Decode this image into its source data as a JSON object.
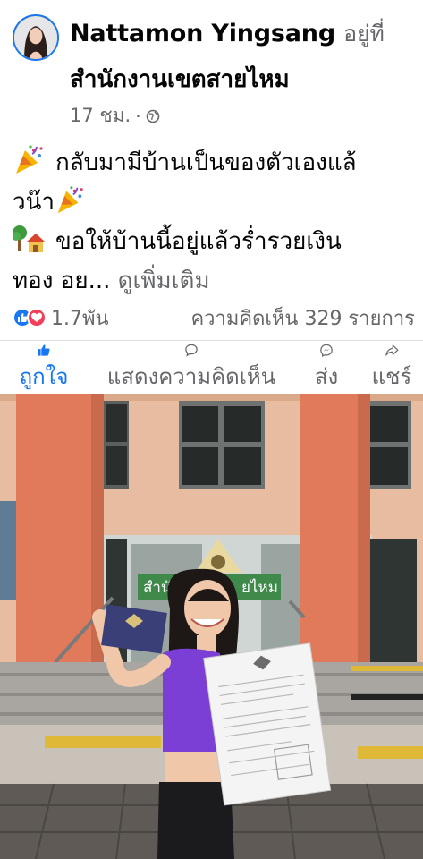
{
  "post": {
    "author": "Nattamon Yingsang",
    "at_word": "อยู่ที่",
    "place": "สำนักงานเขตสายไหม",
    "time": "17 ชม.",
    "separator": "·",
    "privacy_icon": "globe-icon",
    "text_line1": "กลับมามีบ้านเป็นของตัวเองแล้",
    "text_line2": "วน๊า",
    "text_line3": "ขอให้บ้านนี้อยู่แล้วร่ำรวยเงิน",
    "text_line4": "ทอง อย...",
    "see_more": "ดูเพิ่มเติม",
    "emoji_1": "party-popper-emoji",
    "emoji_2": "tree-house-emoji"
  },
  "stats": {
    "reaction_icons": [
      "like-icon",
      "love-icon"
    ],
    "reaction_count": "1.7พัน",
    "comments": "ความคิดเห็น 329 รายการ"
  },
  "actions": [
    {
      "label": "ถูกใจ",
      "icon": "thumbs-up-icon",
      "active": true
    },
    {
      "label": "แสดงความคิดเห็น",
      "icon": "comment-icon",
      "active": false
    },
    {
      "label": "ส่ง",
      "icon": "messenger-icon",
      "active": false
    },
    {
      "label": "แชร์",
      "icon": "share-icon",
      "active": false
    }
  ],
  "photo": {
    "sign_text": "สำนัก",
    "sign_text_right": "ยไหม",
    "colors": {
      "pillar": "#e07a5a",
      "wall": "#e8bca0",
      "floor": "#5f5a55",
      "shirt": "#7b3fd6",
      "yellow_strip": "#e0b838"
    }
  },
  "colors": {
    "accent": "#1877f2",
    "secondary_text": "#65676b",
    "love": "#f33e58"
  }
}
